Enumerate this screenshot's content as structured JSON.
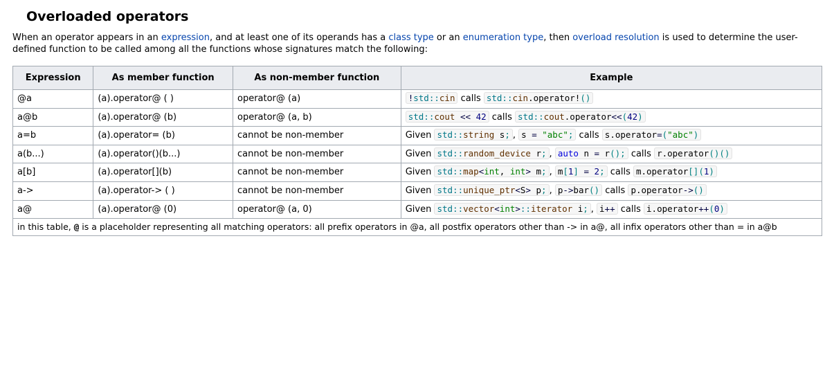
{
  "heading": "Overloaded operators",
  "intro": {
    "t1": "When an operator appears in an ",
    "link_expression": "expression",
    "t2": ", and at least one of its operands has a ",
    "link_class_type": "class type",
    "t3": " or an ",
    "link_enum_type": "enumeration type",
    "t4": ", then ",
    "link_overload_resolution": "overload resolution",
    "t5": " is used to determine the user-defined function to be called among all the functions whose signatures match the following:"
  },
  "headers": {
    "expression": "Expression",
    "member": "As member function",
    "nonmember": "As non-member function",
    "example": "Example"
  },
  "label_cannot": "cannot be non-member",
  "rows": {
    "r1": {
      "expr": "@a",
      "member": "(a).operator@ ( )",
      "nonmember_type": "ok",
      "nonmember": "operator@ (a)",
      "ex_code1": "!std::cin",
      "ex_mid": " calls ",
      "ex_code2a": "std::cin",
      "ex_code2b": ".operator!()"
    },
    "r2": {
      "expr": "a@b",
      "member": "(a).operator@ (b)",
      "nonmember_type": "ok",
      "nonmember": "operator@ (a, b)",
      "ex_code1a": "std::cout",
      "ex_code1b": " << 42",
      "ex_mid": " calls ",
      "ex_code2a": "std::cout",
      "ex_code2b": ".operator<<(42)"
    },
    "r3": {
      "expr": "a=b",
      "member": "(a).operator= (b)",
      "nonmember_type": "no",
      "ex_pre": "Given ",
      "ex_code1a": "std::string",
      "ex_code1b": " s;",
      "ex_comma": ", ",
      "ex_code2": "s = \"abc\";",
      "ex_mid": " calls ",
      "ex_code3": "s.operator=(\"abc\")"
    },
    "r4": {
      "expr": "a(b...)",
      "member": "(a).operator()(b...)",
      "nonmember_type": "no",
      "ex_pre": "Given ",
      "ex_code1a": "std::random_device",
      "ex_code1b": " r;",
      "ex_comma": ", ",
      "ex_code2": "auto n = r();",
      "ex_mid": " calls ",
      "ex_code3": "r.operator()()"
    },
    "r5": {
      "expr": "a[b]",
      "member": "(a).operator[](b)",
      "nonmember_type": "no",
      "ex_pre": "Given ",
      "ex_code1a": "std::map",
      "ex_code1b": "<int, int> m;",
      "ex_comma": ", ",
      "ex_code2": "m[1] = 2;",
      "ex_mid": " calls ",
      "ex_code3": "m.operator[](1)"
    },
    "r6": {
      "expr": "a->",
      "member": "(a).operator-> ( )",
      "nonmember_type": "no",
      "ex_pre": "Given ",
      "ex_code1a": "std::unique_ptr",
      "ex_code1b": "<S> p;",
      "ex_comma": ", ",
      "ex_code2": "p->bar()",
      "ex_mid": " calls ",
      "ex_code3": "p.operator->()"
    },
    "r7": {
      "expr": "a@",
      "member": "(a).operator@ (0)",
      "nonmember_type": "ok",
      "nonmember": "operator@ (a, 0)",
      "ex_pre": "Given ",
      "ex_code1a": "std::vector",
      "ex_code1b": "<int>::iterator i;",
      "ex_comma": ", ",
      "ex_code2": "i++",
      "ex_mid": " calls ",
      "ex_code3": "i.operator++(0)"
    }
  },
  "footer": {
    "t1": "in this table, ",
    "at": "@",
    "t2": " is a placeholder representing all matching operators: all prefix operators in @a, all postfix operators other than -> in a@, all infix operators other than = in a@b"
  }
}
